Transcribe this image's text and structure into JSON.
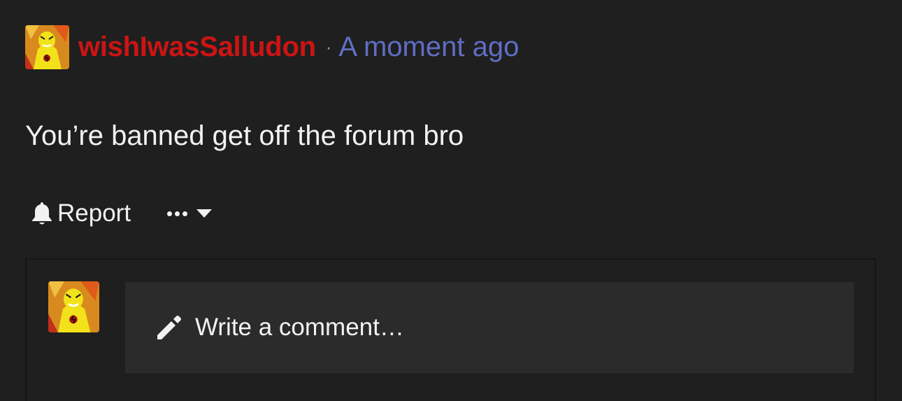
{
  "post": {
    "author": "wishIwasSalludon",
    "separator": "·",
    "timestamp": "A moment ago",
    "body": "You’re banned get off the forum bro",
    "avatar_icon": "yellow-speedster-avatar"
  },
  "actions": {
    "report_label": "Report",
    "report_icon": "bell-icon",
    "more_icon": "ellipsis-icon",
    "dropdown_icon": "caret-down-icon"
  },
  "comment": {
    "placeholder": "Write a comment…",
    "input_icon": "pencil-icon"
  },
  "colors": {
    "background": "#1f1f1f",
    "author": "#cc1414",
    "timestamp": "#5f6ec4",
    "text": "#f2f2f2",
    "comment_field": "#2b2b2b"
  }
}
